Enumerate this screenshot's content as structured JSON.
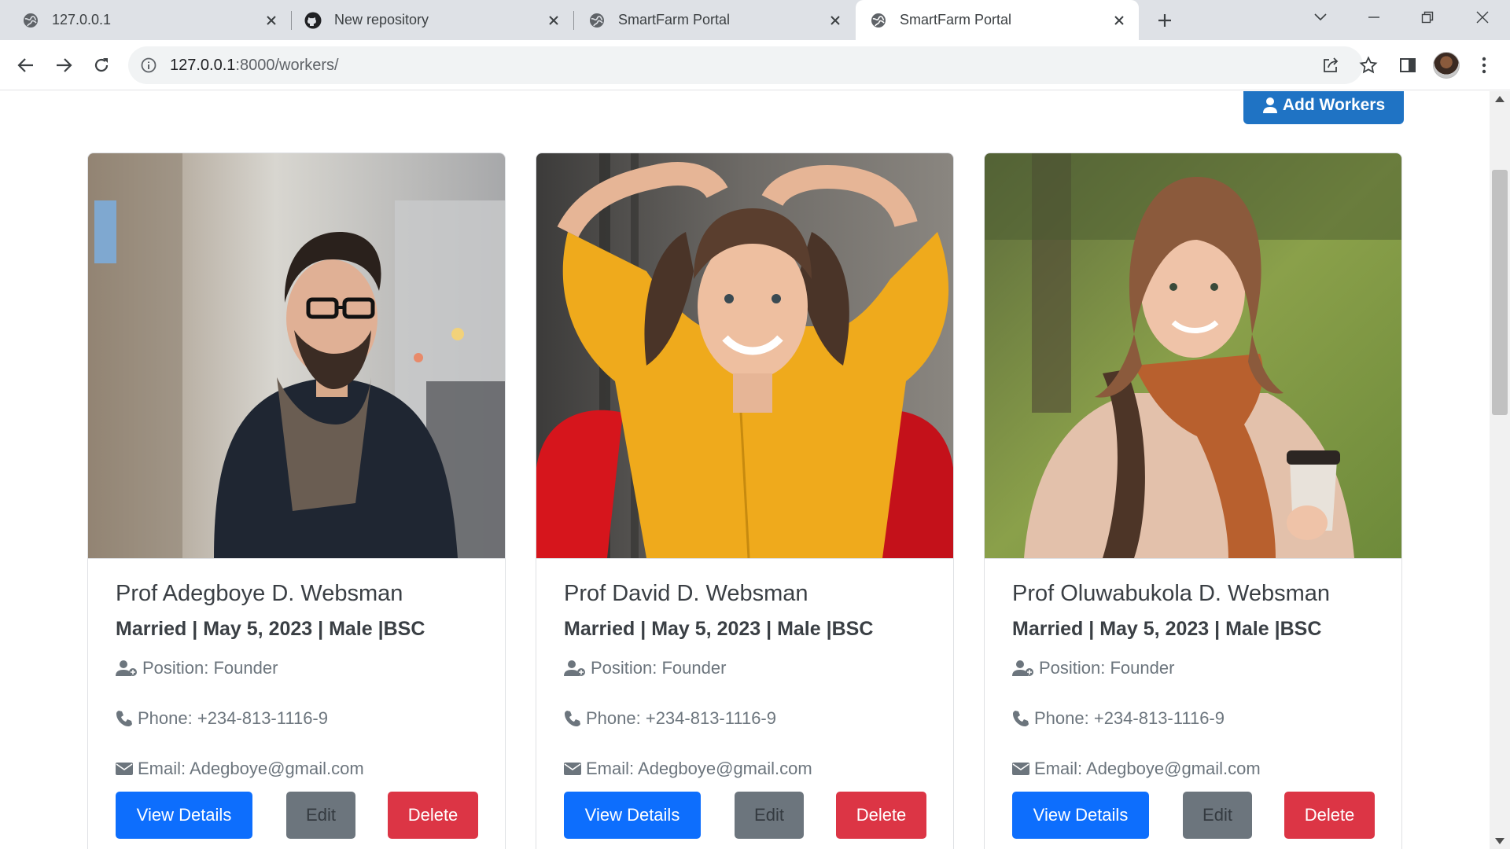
{
  "browser": {
    "tabs": [
      {
        "title": "127.0.0.1",
        "icon": "globe-icon"
      },
      {
        "title": "New repository",
        "icon": "github-icon"
      },
      {
        "title": "SmartFarm Portal",
        "icon": "globe-icon"
      },
      {
        "title": "SmartFarm Portal",
        "icon": "globe-icon",
        "active": true
      }
    ],
    "address": {
      "host": "127.0.0.1",
      "path": ":8000/workers/"
    }
  },
  "page": {
    "add_button_label": "Add Workers",
    "workers": [
      {
        "name": "Prof Adegboye D. Websman",
        "meta": "Married | May 5, 2023 | Male |BSC",
        "position": "Position: Founder",
        "phone": "Phone: +234-813-1116-9",
        "email": "Email: Adegboye@gmail.com",
        "photo": "man-glasses-scarf-street-photo"
      },
      {
        "name": "Prof David D. Websman",
        "meta": "Married | May 5, 2023 | Male |BSC",
        "position": "Position: Founder",
        "phone": "Phone: +234-813-1116-9",
        "email": "Email: Adegboye@gmail.com",
        "photo": "woman-yellow-shirt-red-chair-photo"
      },
      {
        "name": "Prof Oluwabukola D. Websman",
        "meta": "Married | May 5, 2023 | Male |BSC",
        "position": "Position: Founder",
        "phone": "Phone: +234-813-1116-9",
        "email": "Email: Adegboye@gmail.com",
        "photo": "woman-scarf-coffee-park-photo"
      }
    ],
    "buttons": {
      "view": "View Details",
      "edit": "Edit",
      "delete": "Delete"
    }
  },
  "colors": {
    "primary": "#0d6efd",
    "secondary": "#6c757d",
    "danger": "#dc3545",
    "add_button": "#1f73c4"
  }
}
